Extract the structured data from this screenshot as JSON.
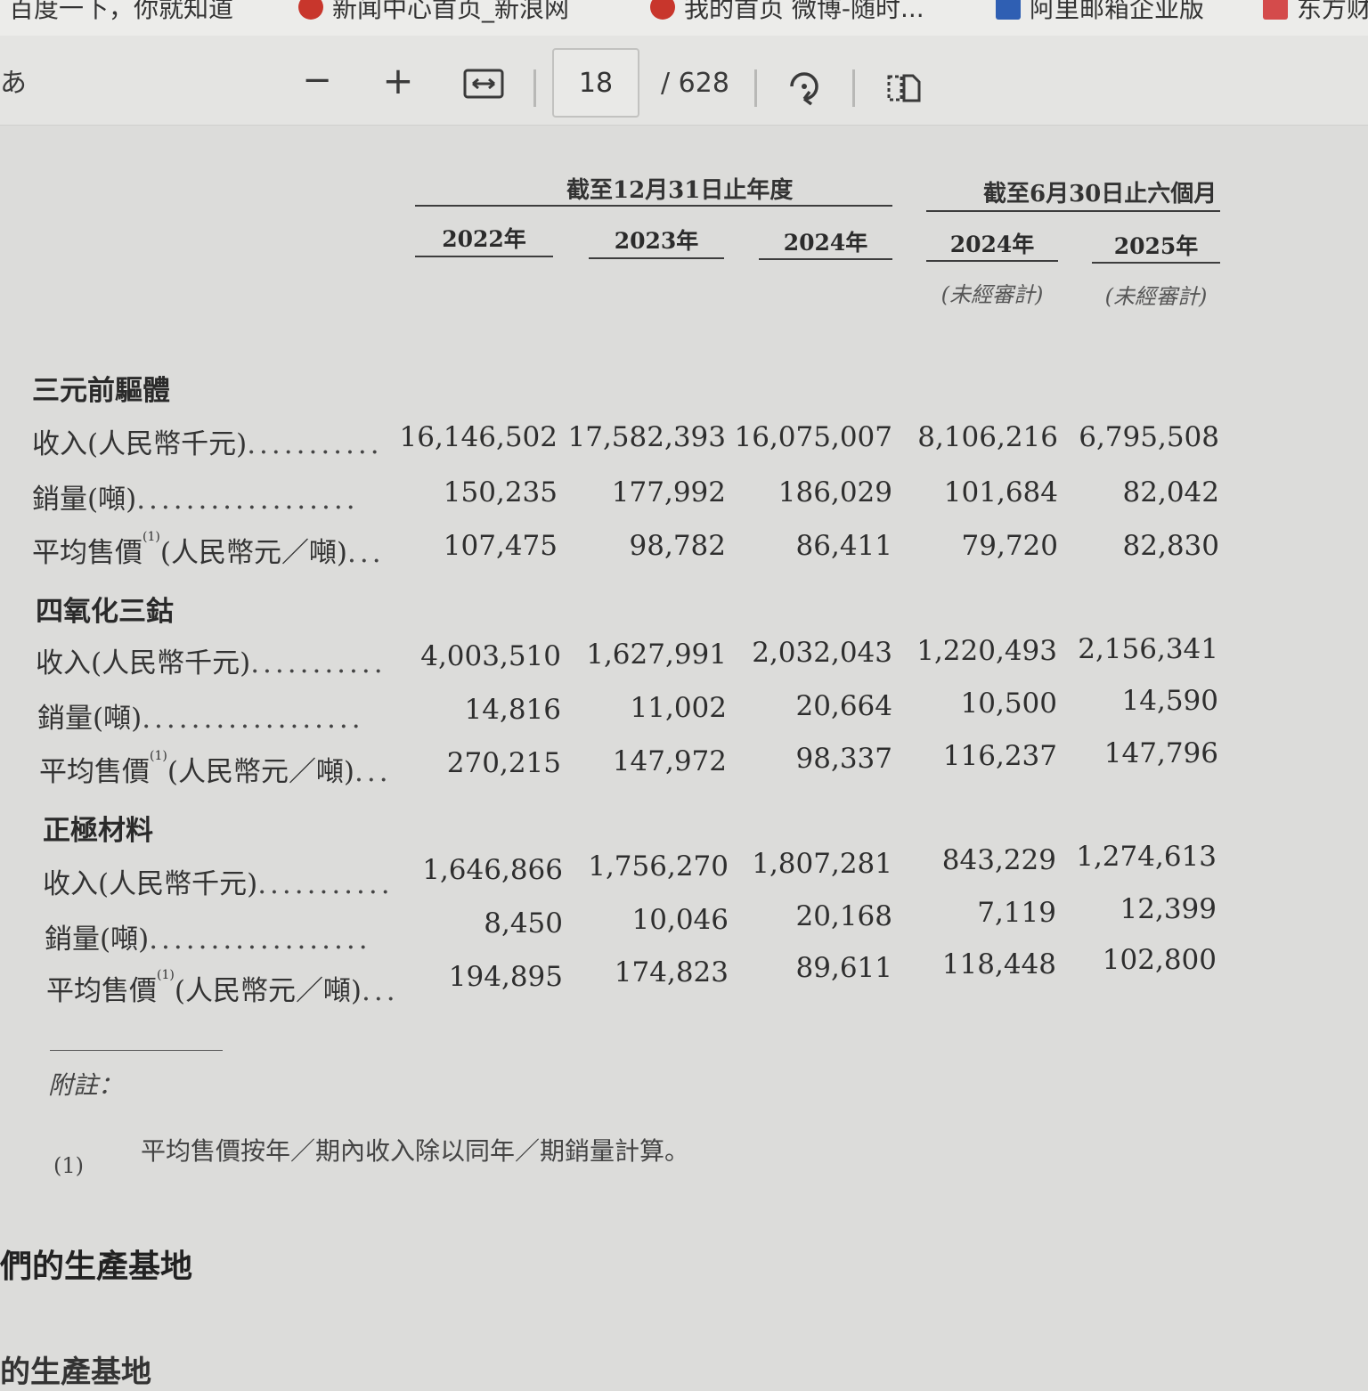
{
  "bookmarks": [
    {
      "label": "百度一下，你就知道"
    },
    {
      "label": "新闻中心首页_新浪网"
    },
    {
      "label": "我的首页 微博-随时..."
    },
    {
      "label": "阿里邮箱企业版"
    },
    {
      "label": "东方财"
    }
  ],
  "toolbar": {
    "left_glyph": "あ",
    "zoom_out": "−",
    "zoom_in": "+",
    "fit_width_icon": "fit-width-icon",
    "current_page": "18",
    "total_pages": "/ 628",
    "rotate_icon": "rotate-icon",
    "two_page_icon": "page-view-icon"
  },
  "table": {
    "group_headers": [
      "截至12月31日止年度",
      "截至6月30日止六個月"
    ],
    "years": [
      "2022年",
      "2023年",
      "2024年",
      "2024年",
      "2025年"
    ],
    "unaudited": [
      "(未經審計)",
      "(未經審計)"
    ],
    "sections": [
      {
        "title": "三元前驅體",
        "rows": [
          {
            "label": "收入(人民幣千元)",
            "sup": "",
            "dots": "...........",
            "values": [
              "16,146,502",
              "17,582,393",
              "16,075,007",
              "8,106,216",
              "6,795,508"
            ]
          },
          {
            "label": "銷量(噸)",
            "sup": "",
            "dots": "..................",
            "values": [
              "150,235",
              "177,992",
              "186,029",
              "101,684",
              "82,042"
            ]
          },
          {
            "label": "平均售價",
            "sup": "(1)",
            "label_suffix": "(人民幣元／噸)",
            "dots": "...",
            "values": [
              "107,475",
              "98,782",
              "86,411",
              "79,720",
              "82,830"
            ]
          }
        ]
      },
      {
        "title": "四氧化三鈷",
        "rows": [
          {
            "label": "收入(人民幣千元)",
            "sup": "",
            "dots": "...........",
            "values": [
              "4,003,510",
              "1,627,991",
              "2,032,043",
              "1,220,493",
              "2,156,341"
            ]
          },
          {
            "label": "銷量(噸)",
            "sup": "",
            "dots": "..................",
            "values": [
              "14,816",
              "11,002",
              "20,664",
              "10,500",
              "14,590"
            ]
          },
          {
            "label": "平均售價",
            "sup": "(1)",
            "label_suffix": "(人民幣元／噸)",
            "dots": "...",
            "values": [
              "270,215",
              "147,972",
              "98,337",
              "116,237",
              "147,796"
            ]
          }
        ]
      },
      {
        "title": "正極材料",
        "rows": [
          {
            "label": "收入(人民幣千元)",
            "sup": "",
            "dots": "...........",
            "values": [
              "1,646,866",
              "1,756,270",
              "1,807,281",
              "843,229",
              "1,274,613"
            ]
          },
          {
            "label": "銷量(噸)",
            "sup": "",
            "dots": "..................",
            "values": [
              "8,450",
              "10,046",
              "20,168",
              "7,119",
              "12,399"
            ]
          },
          {
            "label": "平均售價",
            "sup": "(1)",
            "label_suffix": "(人民幣元／噸)",
            "dots": "...",
            "values": [
              "194,895",
              "174,823",
              "89,611",
              "118,448",
              "102,800"
            ]
          }
        ]
      }
    ]
  },
  "notes": {
    "title": "附註：",
    "items": [
      {
        "marker": "(1)",
        "text": "平均售價按年／期內收入除以同年／期銷量計算。"
      }
    ]
  },
  "heading_partial": "們的生產基地",
  "heading_partial_2": "的生產基地"
}
